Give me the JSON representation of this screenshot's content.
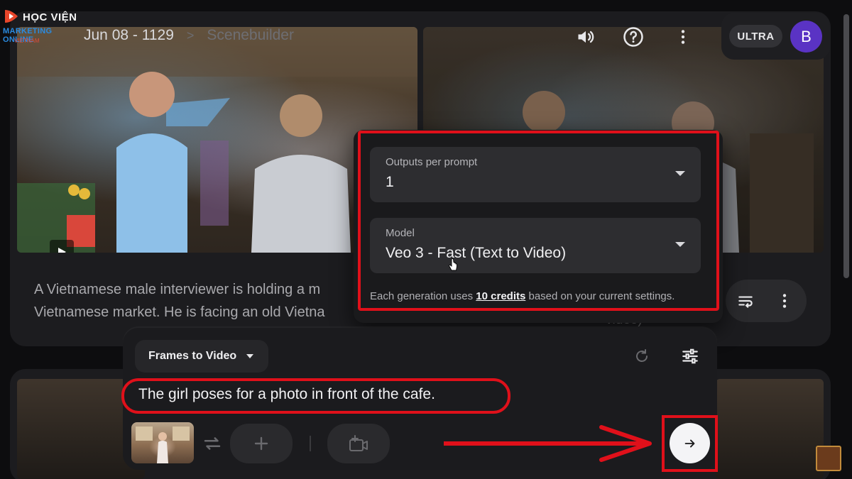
{
  "logo": {
    "line1": "HỌC VIỆN",
    "line2": "MARKETING ONLINE",
    "line3": "VIETNAM"
  },
  "header": {
    "breadcrumb": [
      "Jun 08 - 1129",
      "Scenebuilder"
    ],
    "separator": ">",
    "icons": [
      "volume-icon",
      "help-icon",
      "more-vert-icon"
    ],
    "plan_badge": "ULTRA",
    "avatar_initial": "B"
  },
  "scene_card": {
    "description": "A Vietnamese male interviewer is holding a m\nVietnamese market. He is facing an old Vietna",
    "trailing_text": "video)"
  },
  "settings": {
    "outputs": {
      "label": "Outputs per prompt",
      "value": "1"
    },
    "model": {
      "label": "Model",
      "value": "Veo 3 - Fast (Text to Video)"
    },
    "credits_prefix": "Each generation uses ",
    "credits_link": "10 credits",
    "credits_suffix": " based on your current settings."
  },
  "composer": {
    "mode": "Frames to Video",
    "prompt": "The girl poses for a photo in front of the cafe.",
    "icons": [
      "refresh-icon",
      "tune-icon",
      "swap-icon",
      "add-icon",
      "add-frame-icon",
      "arrow-forward-icon"
    ]
  },
  "colors": {
    "background": "#0d0d0f",
    "annotation_red": "#e0101a",
    "avatar": "#5a33c4",
    "send_button": "#f4f4f6"
  }
}
